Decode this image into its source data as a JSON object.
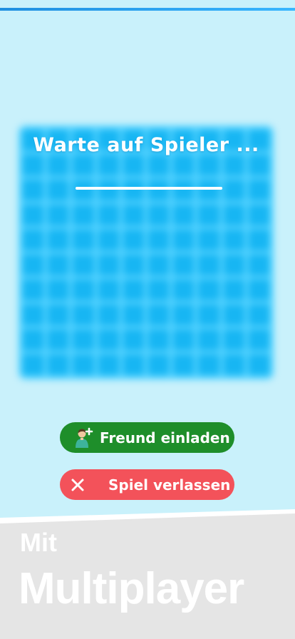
{
  "waiting": {
    "text": "Warte auf Spieler ...",
    "progress": 1.0
  },
  "buttons": {
    "invite_label": "Freund einladen",
    "invite_icon": "add-friend-icon",
    "leave_label": "Spiel verlassen",
    "leave_icon": "close-icon"
  },
  "footer": {
    "line1": "Mit",
    "line2": "Multiplayer"
  },
  "colors": {
    "background": "#c9f1fb",
    "board": "#17b6f3",
    "invite_button": "#1e8e2a",
    "leave_button": "#f3525a",
    "footer": "#e5e5e5"
  }
}
